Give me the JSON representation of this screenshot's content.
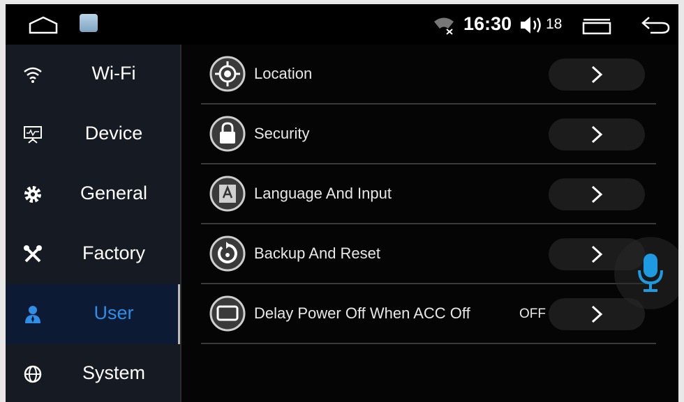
{
  "status_bar": {
    "time": "16:30",
    "volume": "18",
    "icons": [
      "home-outline-icon",
      "settings-app-icon",
      "wifi-off-icon",
      "volume-icon",
      "recent-apps-icon",
      "back-arrow-icon"
    ]
  },
  "sidebar": {
    "items": [
      {
        "label": "Wi-Fi",
        "icon": "wifi-icon"
      },
      {
        "label": "Device",
        "icon": "device-monitor-icon"
      },
      {
        "label": "General",
        "icon": "gear-icon"
      },
      {
        "label": "Factory",
        "icon": "tools-icon"
      },
      {
        "label": "User",
        "icon": "user-icon",
        "active": true
      },
      {
        "label": "System",
        "icon": "globe-icon"
      }
    ]
  },
  "main": {
    "rows": [
      {
        "label": "Location",
        "icon": "location-target-icon",
        "value": ""
      },
      {
        "label": "Security",
        "icon": "lock-icon",
        "value": ""
      },
      {
        "label": "Language And Input",
        "icon": "language-keyboard-icon",
        "value": ""
      },
      {
        "label": "Backup And Reset",
        "icon": "backup-reset-icon",
        "value": ""
      },
      {
        "label": "Delay Power Off When ACC Off",
        "icon": "screen-icon",
        "value": "OFF"
      }
    ]
  },
  "floating": {
    "icon": "microphone-icon"
  },
  "colors": {
    "accent": "#2f8ee8",
    "sidebar_bg": "#161a22",
    "active_bg": "#0c1a33",
    "mic": "#1e9be0"
  }
}
